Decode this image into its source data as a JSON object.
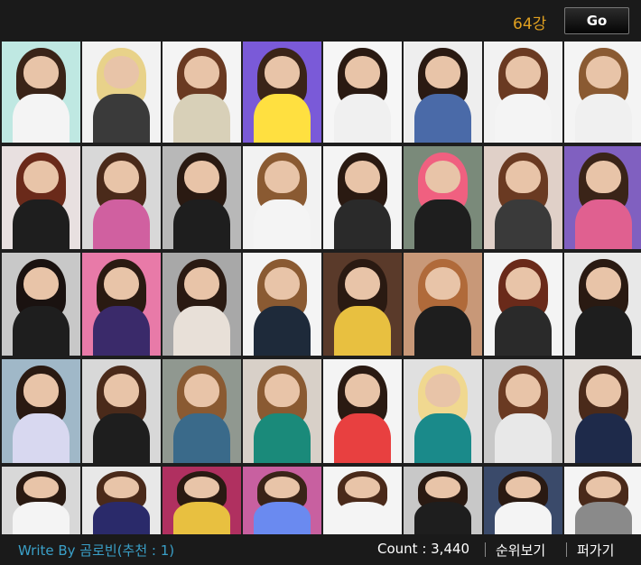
{
  "header": {
    "round_label": "64강",
    "go_label": "Go"
  },
  "grid": {
    "tiles": [
      {
        "bg": "#bfe8e2",
        "hair": "#3a2418",
        "body": "#f4f4f4"
      },
      {
        "bg": "#f2f2f2",
        "hair": "#e8d28a",
        "body": "#3a3a3a"
      },
      {
        "bg": "#f4f4f4",
        "hair": "#6a3a22",
        "body": "#d8d0b8"
      },
      {
        "bg": "#7a5ad8",
        "hair": "#3a2418",
        "body": "#ffe040"
      },
      {
        "bg": "#f6f6f6",
        "hair": "#2a1a12",
        "body": "#f0f0f0"
      },
      {
        "bg": "#eeeeee",
        "hair": "#2a1a12",
        "body": "#4a6aa8"
      },
      {
        "bg": "#f2f2f2",
        "hair": "#6a3a22",
        "body": "#f4f4f4"
      },
      {
        "bg": "#f4f4f4",
        "hair": "#8a5a32",
        "body": "#f0f0f0"
      },
      {
        "bg": "#e8e0e0",
        "hair": "#6a2a1a",
        "body": "#1e1e1e"
      },
      {
        "bg": "#d8d8d8",
        "hair": "#4a2a1a",
        "body": "#d060a0"
      },
      {
        "bg": "#b8b8b8",
        "hair": "#2a1a12",
        "body": "#1e1e1e"
      },
      {
        "bg": "#f2f2f2",
        "hair": "#8a5a32",
        "body": "#f4f4f4"
      },
      {
        "bg": "#f4f4f4",
        "hair": "#2a1a12",
        "body": "#2a2a2a"
      },
      {
        "bg": "#7a8a7a",
        "hair": "#f06080",
        "body": "#1e1e1e"
      },
      {
        "bg": "#e0d0c8",
        "hair": "#6a3a22",
        "body": "#3a3a3a"
      },
      {
        "bg": "#8060c0",
        "hair": "#3a2418",
        "body": "#e06090"
      },
      {
        "bg": "#c8c8c8",
        "hair": "#1a1210",
        "body": "#1e1e1e"
      },
      {
        "bg": "#e87aa8",
        "hair": "#2a1a12",
        "body": "#3a2a6a"
      },
      {
        "bg": "#a8a8a8",
        "hair": "#2a1a12",
        "body": "#e8e0d8"
      },
      {
        "bg": "#f4f4f4",
        "hair": "#8a5a32",
        "body": "#1e2a3a"
      },
      {
        "bg": "#5a3a2a",
        "hair": "#2a1a12",
        "body": "#e8c040"
      },
      {
        "bg": "#c89878",
        "hair": "#b06a3a",
        "body": "#1e1e1e"
      },
      {
        "bg": "#f4f4f4",
        "hair": "#6a2a1a",
        "body": "#2a2a2a"
      },
      {
        "bg": "#e8e8e8",
        "hair": "#2a1a12",
        "body": "#1e1e1e"
      },
      {
        "bg": "#a0b8c8",
        "hair": "#2a1a12",
        "body": "#d8d8f0"
      },
      {
        "bg": "#d8d8d8",
        "hair": "#4a2a1a",
        "body": "#1e1e1e"
      },
      {
        "bg": "#909890",
        "hair": "#8a5a32",
        "body": "#3a6a8a"
      },
      {
        "bg": "#d8d0c8",
        "hair": "#8a5a32",
        "body": "#1a8a7a"
      },
      {
        "bg": "#f4f4f4",
        "hair": "#2a1a12",
        "body": "#e84040"
      },
      {
        "bg": "#e0e0e0",
        "hair": "#f0d890",
        "body": "#1a8a8a"
      },
      {
        "bg": "#c8c8c8",
        "hair": "#6a3a22",
        "body": "#e8e8e8"
      },
      {
        "bg": "#e0dcd8",
        "hair": "#4a2a1a",
        "body": "#1e2a4a"
      },
      {
        "bg": "#d8d8d8",
        "hair": "#2a1a12",
        "body": "#f4f4f4"
      },
      {
        "bg": "#e8e8e8",
        "hair": "#4a2a1a",
        "body": "#2a2a6a"
      },
      {
        "bg": "#b03060",
        "hair": "#2a1a12",
        "body": "#e8c040"
      },
      {
        "bg": "#c860a0",
        "hair": "#3a2418",
        "body": "#6a8af0"
      },
      {
        "bg": "#f4f4f4",
        "hair": "#4a2a1a",
        "body": "#f4f4f4"
      },
      {
        "bg": "#c8c8c8",
        "hair": "#2a1a12",
        "body": "#1e1e1e"
      },
      {
        "bg": "#3a4a6a",
        "hair": "#2a1a12",
        "body": "#f4f4f4"
      },
      {
        "bg": "#f4f4f4",
        "hair": "#4a2a1a",
        "body": "#8a8a8a"
      }
    ]
  },
  "footer": {
    "write_by": "Write By 곰로빈(추천 : 1)",
    "count": "Count : 3,440",
    "ranking_link": "순위보기",
    "share_link": "퍼가기"
  }
}
